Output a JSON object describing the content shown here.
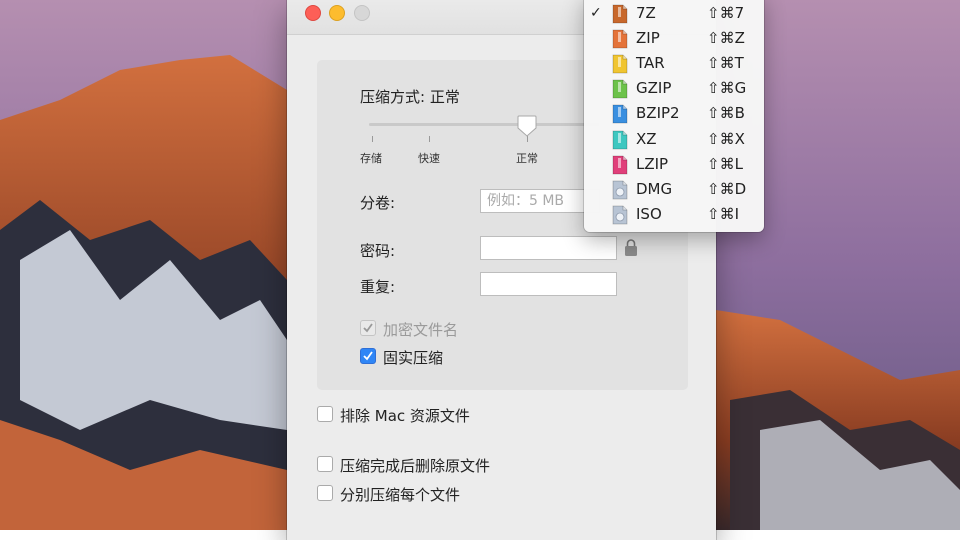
{
  "window": {
    "compression": {
      "label": "压缩方式: 正常",
      "ticks": [
        "存储",
        "快速",
        "正常"
      ]
    },
    "split": {
      "label": "分卷:",
      "placeholder": "例如：5 MB"
    },
    "password": {
      "label": "密码:",
      "value": ""
    },
    "repeat": {
      "label": "重复:",
      "value": ""
    },
    "encrypt_filenames": {
      "label": "加密文件名",
      "checked": true,
      "enabled": false
    },
    "solid": {
      "label": "固实压缩",
      "checked": true
    },
    "exclude_mac": {
      "label": "排除 Mac 资源文件",
      "checked": false
    },
    "delete_after": {
      "label": "压缩完成后删除原文件",
      "checked": false
    },
    "each_separately": {
      "label": "分别压缩每个文件",
      "checked": false
    }
  },
  "format_menu": {
    "selected": "7Z",
    "items": [
      {
        "name": "7Z",
        "shortcut": "⇧⌘7",
        "icon": "7z-archive-icon",
        "color": "#c8682c"
      },
      {
        "name": "ZIP",
        "shortcut": "⇧⌘Z",
        "icon": "zip-archive-icon",
        "color": "#e4733a"
      },
      {
        "name": "TAR",
        "shortcut": "⇧⌘T",
        "icon": "tar-archive-icon",
        "color": "#f0c531"
      },
      {
        "name": "GZIP",
        "shortcut": "⇧⌘G",
        "icon": "gzip-archive-icon",
        "color": "#6cc24a"
      },
      {
        "name": "BZIP2",
        "shortcut": "⇧⌘B",
        "icon": "bzip2-archive-icon",
        "color": "#3a8fe0"
      },
      {
        "name": "XZ",
        "shortcut": "⇧⌘X",
        "icon": "xz-archive-icon",
        "color": "#3ec7c0"
      },
      {
        "name": "LZIP",
        "shortcut": "⇧⌘L",
        "icon": "lzip-archive-icon",
        "color": "#e03f7a"
      },
      {
        "name": "DMG",
        "shortcut": "⇧⌘D",
        "icon": "dmg-disk-icon",
        "color": "#b8c4d4"
      },
      {
        "name": "ISO",
        "shortcut": "⇧⌘I",
        "icon": "iso-disk-icon",
        "color": "#b8c4d4"
      }
    ]
  }
}
